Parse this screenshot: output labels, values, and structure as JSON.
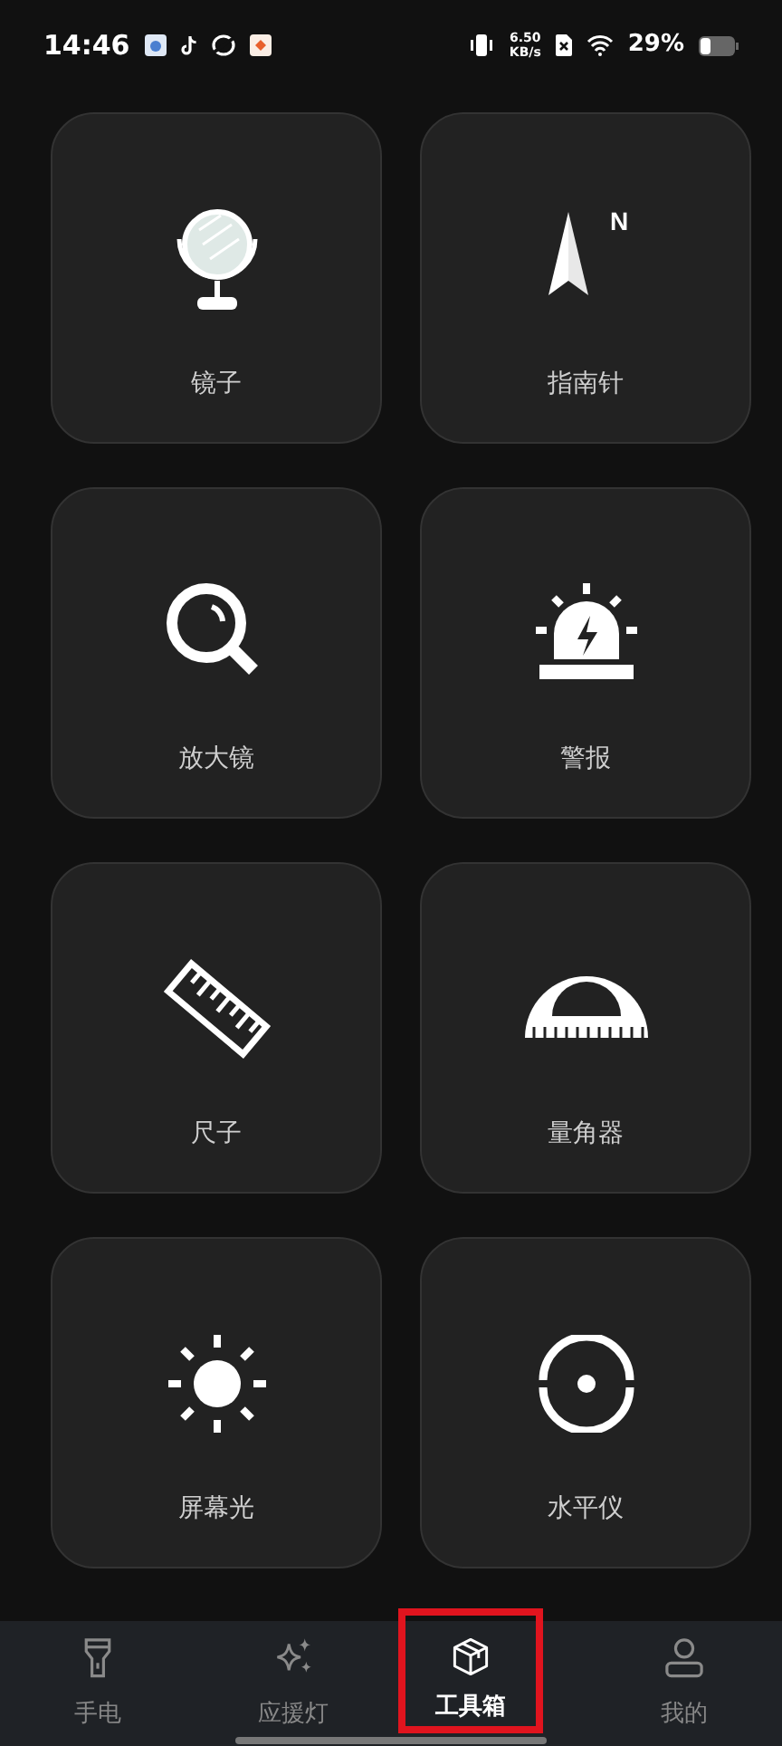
{
  "status_bar": {
    "time": "14:46",
    "net_speed": "6.50",
    "net_unit": "KB/s",
    "battery": "29%"
  },
  "compass_letter": "N",
  "tools": [
    {
      "label": "镜子"
    },
    {
      "label": "指南针"
    },
    {
      "label": "放大镜"
    },
    {
      "label": "警报"
    },
    {
      "label": "尺子"
    },
    {
      "label": "量角器"
    },
    {
      "label": "屏幕光"
    },
    {
      "label": "水平仪"
    }
  ],
  "bottom_nav": [
    {
      "label": "手电",
      "selected": false,
      "highlighted": false
    },
    {
      "label": "应援灯",
      "selected": false,
      "highlighted": false
    },
    {
      "label": "工具箱",
      "selected": true,
      "highlighted": true
    },
    {
      "label": "我的",
      "selected": false,
      "highlighted": false
    }
  ]
}
